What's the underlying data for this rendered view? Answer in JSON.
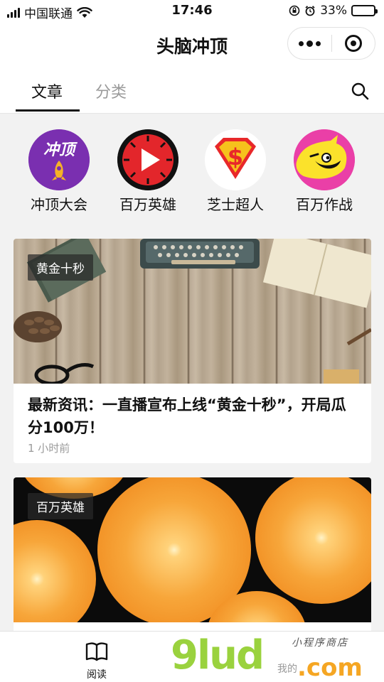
{
  "status_bar": {
    "carrier": "中国联通",
    "time": "17:46",
    "battery": "33%",
    "battery_level": 0.33
  },
  "nav": {
    "title": "头脑冲顶"
  },
  "tabs": {
    "items": [
      {
        "label": "文章",
        "active": true
      },
      {
        "label": "分类",
        "active": false
      }
    ]
  },
  "categories": [
    {
      "label": "冲顶大会",
      "icon": "chongding-logo-icon",
      "logo_text": "冲顶",
      "color": "#7a2fb0"
    },
    {
      "label": "百万英雄",
      "icon": "play-button-icon",
      "color": "#e3262b"
    },
    {
      "label": "芝士超人",
      "icon": "dollar-shield-icon",
      "logo_text": "$",
      "color": "#e8282a"
    },
    {
      "label": "百万作战",
      "icon": "yellow-face-icon",
      "color": "#ea3fa7"
    }
  ],
  "articles": [
    {
      "tag": "黄金十秒",
      "title": "最新资讯：一直播宣布上线“黄金十秒”，开局瓜分100万！",
      "time": "1 小时前",
      "image": "wooden-desk-typewriter-image"
    },
    {
      "tag": "百万英雄",
      "title": "",
      "time": "",
      "image": "sliced-oranges-image"
    }
  ],
  "tabbar": {
    "items": [
      {
        "label": "阅读",
        "icon": "book-icon",
        "active": true
      },
      {
        "label": "我的",
        "icon": "user-icon",
        "active": false
      }
    ]
  },
  "watermark": {
    "logo": "9lud",
    "domain": ".com",
    "tagline": "小程序商店"
  }
}
